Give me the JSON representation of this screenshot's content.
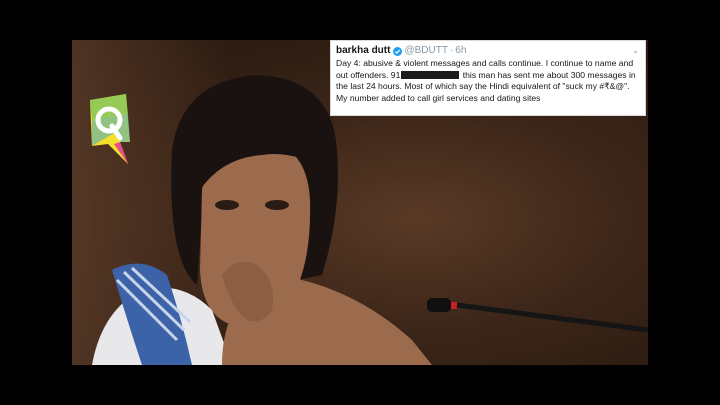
{
  "brand": {
    "logo_icon": "quint-q-logo-icon",
    "colors": {
      "yellow": "#f2e02b",
      "pink": "#e84d8a",
      "blue": "#30a4dc",
      "green": "#6ec06b"
    }
  },
  "photo": {
    "subject_icon": "person-thinking-photo",
    "microphone_icon": "microphone-icon"
  },
  "tweet": {
    "name": "barkha dutt",
    "handle": "@BDUTT",
    "separator": "·",
    "time": "6h",
    "text_part1": "Day 4: abusive & violent messages and calls continue. I continue to name and out offenders. 91",
    "text_part2": " this man has sent me about 300 messages in the last 24 hours. Most of which say the Hindi equivalent of \"suck my #₹&@\". My number added to call girl services and dating sites",
    "verified_icon": "verified-badge-icon",
    "menu_icon": "chevron-down-icon"
  }
}
